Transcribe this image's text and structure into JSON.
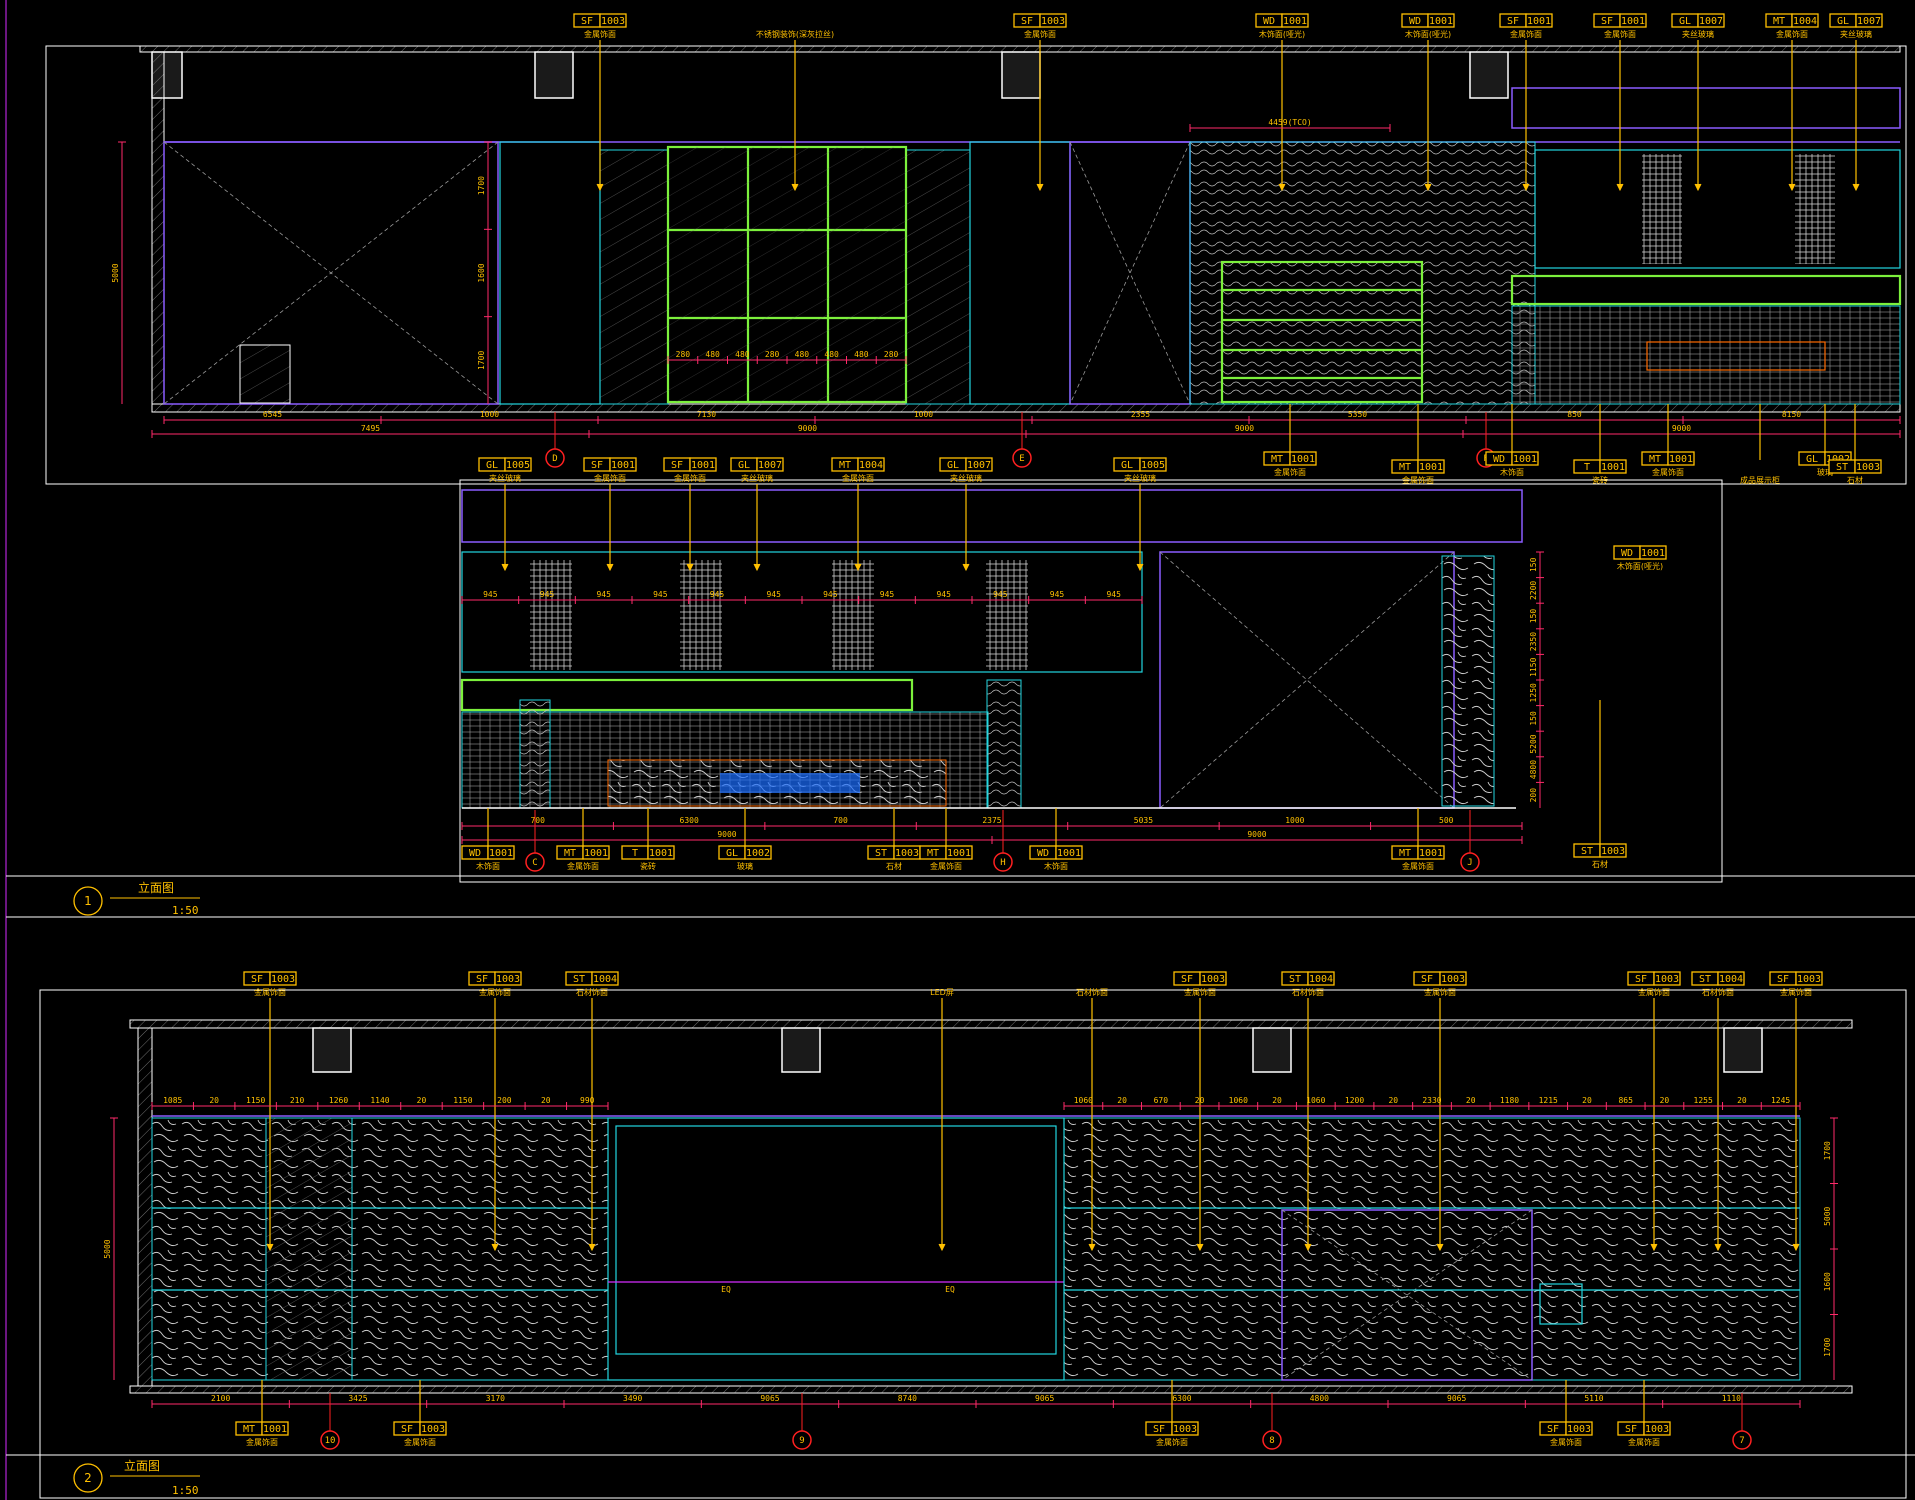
{
  "elevation_1": {
    "number": "1",
    "title": "立面图",
    "scale": "1:50",
    "top_tags": [
      {
        "code": "SF",
        "num": "1003",
        "caption": "金属饰面"
      },
      {
        "code": "",
        "num": "",
        "caption": "不锈钢装饰(深灰拉丝)"
      },
      {
        "code": "SF",
        "num": "1003",
        "caption": "金属饰面"
      },
      {
        "code": "WD",
        "num": "1001",
        "caption": "木饰面(哑光)"
      },
      {
        "code": "WD",
        "num": "1001",
        "caption": "木饰面(哑光)"
      },
      {
        "code": "SF",
        "num": "1001",
        "caption": "金属饰面"
      },
      {
        "code": "SF",
        "num": "1001",
        "caption": "金属饰面"
      },
      {
        "code": "GL",
        "num": "1007",
        "caption": "夹丝玻璃"
      },
      {
        "code": "MT",
        "num": "1004",
        "caption": "金属饰面"
      },
      {
        "code": "GL",
        "num": "1007",
        "caption": "夹丝玻璃"
      }
    ],
    "dims_bottom": [
      "6545",
      "1000",
      "7130",
      "1000",
      "2355",
      "5350",
      "850",
      "8150"
    ],
    "dims_total": [
      "7495",
      "9000",
      "9000",
      "9000"
    ],
    "dims_left": [
      "5000"
    ],
    "dims_vertical": [
      "1700",
      "1600",
      "1700"
    ],
    "dims_upper": [
      "4459(TCO)"
    ],
    "dims_window": [
      "280",
      "480",
      "480",
      "280",
      "480",
      "480",
      "480",
      "280"
    ],
    "grid": [
      "D",
      "E",
      "F"
    ],
    "bottom_tags": [
      {
        "code": "MT",
        "num": "1001",
        "caption": "金属饰面"
      },
      {
        "code": "MT",
        "num": "1001",
        "caption": "金属饰面"
      },
      {
        "code": "WD",
        "num": "1001",
        "caption": "木饰面"
      },
      {
        "code": "T",
        "num": "1001",
        "caption": "瓷砖"
      },
      {
        "code": "MT",
        "num": "1001",
        "caption": "金属饰面"
      },
      {
        "code": "",
        "num": "",
        "caption": "成品展示柜"
      },
      {
        "code": "GL",
        "num": "1002",
        "caption": "玻璃"
      },
      {
        "code": "ST",
        "num": "1003",
        "caption": "石材"
      }
    ]
  },
  "elevation_1b": {
    "top_tags": [
      {
        "code": "GL",
        "num": "1005",
        "caption": "夹丝玻璃"
      },
      {
        "code": "SF",
        "num": "1001",
        "caption": "金属饰面"
      },
      {
        "code": "SF",
        "num": "1001",
        "caption": "金属饰面"
      },
      {
        "code": "GL",
        "num": "1007",
        "caption": "夹丝玻璃"
      },
      {
        "code": "MT",
        "num": "1004",
        "caption": "金属饰面"
      },
      {
        "code": "GL",
        "num": "1007",
        "caption": "夹丝玻璃"
      },
      {
        "code": "GL",
        "num": "1005",
        "caption": "夹丝玻璃"
      }
    ],
    "right_tag": {
      "code": "WD",
      "num": "1001",
      "caption": "木饰面(哑光)"
    },
    "bay_dims": [
      "945",
      "945",
      "945",
      "945",
      "945",
      "945",
      "945",
      "945",
      "945",
      "945",
      "945",
      "945"
    ],
    "dims_bottom": [
      "700",
      "6300",
      "700",
      "2375",
      "5035",
      "1000",
      "500"
    ],
    "dims_total": [
      "9000",
      "9000"
    ],
    "dims_vertical": [
      "150",
      "2200",
      "150",
      "2350",
      "1150",
      "1250",
      "150",
      "5200",
      "4800",
      "200"
    ],
    "grid": [
      "C",
      "H",
      "J"
    ],
    "bottom_tags": [
      {
        "code": "WD",
        "num": "1001",
        "caption": "木饰面"
      },
      {
        "code": "MT",
        "num": "1001",
        "caption": "金属饰面"
      },
      {
        "code": "T",
        "num": "1001",
        "caption": "瓷砖"
      },
      {
        "code": "GL",
        "num": "1002",
        "caption": "玻璃"
      },
      {
        "code": "ST",
        "num": "1003",
        "caption": "石材"
      },
      {
        "code": "MT",
        "num": "1001",
        "caption": "金属饰面"
      },
      {
        "code": "WD",
        "num": "1001",
        "caption": "木饰面"
      },
      {
        "code": "MT",
        "num": "1001",
        "caption": "金属饰面"
      }
    ],
    "side_tag": {
      "code": "ST",
      "num": "1003",
      "caption": "石材"
    }
  },
  "elevation_2": {
    "number": "2",
    "title": "立面图",
    "scale": "1:50",
    "top_tags": [
      {
        "code": "SF",
        "num": "1003",
        "caption": "金属饰面"
      },
      {
        "code": "SF",
        "num": "1003",
        "caption": "金属饰面"
      },
      {
        "code": "ST",
        "num": "1004",
        "caption": "石材饰面"
      },
      {
        "code": "",
        "num": "",
        "caption": "LED屏"
      },
      {
        "code": "",
        "num": "",
        "caption": "石材饰面"
      },
      {
        "code": "SF",
        "num": "1003",
        "caption": "金属饰面"
      },
      {
        "code": "ST",
        "num": "1004",
        "caption": "石材饰面"
      },
      {
        "code": "SF",
        "num": "1003",
        "caption": "金属饰面"
      },
      {
        "code": "SF",
        "num": "1003",
        "caption": "金属饰面"
      },
      {
        "code": "ST",
        "num": "1004",
        "caption": "石材饰面"
      },
      {
        "code": "SF",
        "num": "1003",
        "caption": "金属饰面"
      }
    ],
    "dims_top_left": [
      "1085",
      "20",
      "1150",
      "210",
      "1260",
      "1140",
      "20",
      "1150",
      "200",
      "20",
      "990"
    ],
    "dims_top_right": [
      "1060",
      "20",
      "670",
      "20",
      "1060",
      "20",
      "1060",
      "1200",
      "20",
      "2330",
      "20",
      "1180",
      "1215",
      "20",
      "865",
      "20",
      "1255",
      "20",
      "1245"
    ],
    "dims_bottom": [
      "2100",
      "3425",
      "3170",
      "3490",
      "9065",
      "8740",
      "9065",
      "6300",
      "4800",
      "9065",
      "5110",
      "1110"
    ],
    "dims_left": [
      "5000"
    ],
    "dims_right": [
      "1700",
      "5000",
      "1600",
      "1700"
    ],
    "labels": [
      "EQ",
      "EQ"
    ],
    "grid": [
      "10",
      "9",
      "8",
      "7"
    ],
    "bottom_tags": [
      {
        "code": "MT",
        "num": "1001",
        "caption": "金属饰面"
      },
      {
        "code": "SF",
        "num": "1003",
        "caption": "金属饰面"
      },
      {
        "code": "SF",
        "num": "1003",
        "caption": "金属饰面"
      },
      {
        "code": "SF",
        "num": "1003",
        "caption": "金属饰面"
      },
      {
        "code": "SF",
        "num": "1003",
        "caption": "金属饰面"
      }
    ]
  },
  "colors": {
    "background": "#000000",
    "annotation": "#ffc000",
    "dimension": "#ff2a6a",
    "grid_circle": "#ff2020",
    "cyan_frame": "#22d6e0",
    "green_frame": "#7cf03c",
    "purple_line": "#8a5cff",
    "wall": "#ffffff"
  }
}
